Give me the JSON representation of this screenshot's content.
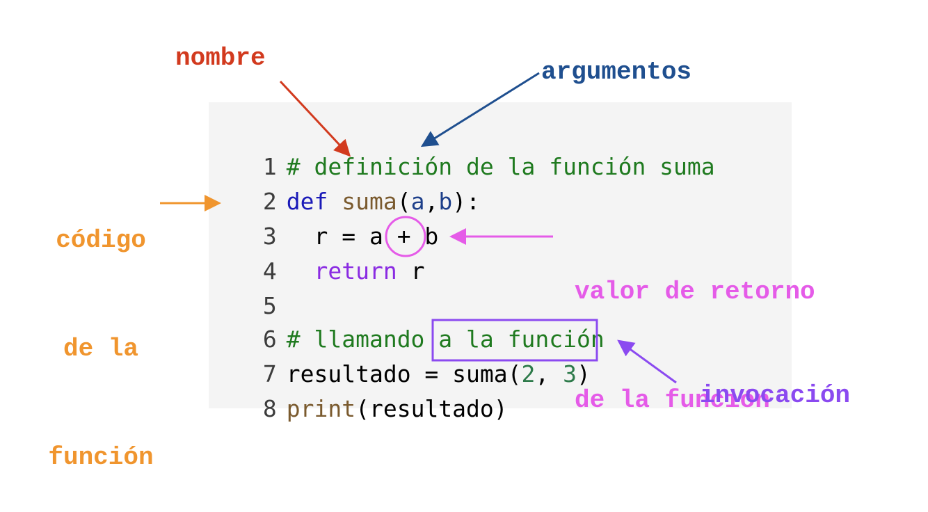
{
  "code": {
    "lines": [
      {
        "num": "1",
        "comment": "# definición de la función suma"
      },
      {
        "num": "2",
        "kw": "def",
        "fn": "suma",
        "paren_open": "(",
        "a": "a",
        "comma": ",",
        "b": "b",
        "paren_close": "):"
      },
      {
        "num": "3",
        "text": "  r = a + b"
      },
      {
        "num": "4",
        "indent": "  ",
        "kw": "return",
        "space": " ",
        "r": "r"
      },
      {
        "num": "5"
      },
      {
        "num": "6",
        "comment": "# llamando a la función"
      },
      {
        "num": "7",
        "lhs": "resultado = ",
        "fn": "suma",
        "paren_open": "(",
        "n1": "2",
        "comma": ", ",
        "n2": "3",
        "paren_close": ")"
      },
      {
        "num": "8",
        "fn": "print",
        "paren_open": "(",
        "arg": "resultado",
        "paren_close": ")"
      }
    ]
  },
  "annotations": {
    "nombre": "nombre",
    "argumentos": "argumentos",
    "codigo_funcion": [
      "código",
      "de la",
      "función"
    ],
    "valor_retorno": [
      "valor de retorno",
      "de la función"
    ],
    "invocacion": "invocación"
  },
  "colors": {
    "nombre": "#d23a1e",
    "argumentos": "#1f4f8f",
    "codigo_funcion": "#f0952e",
    "valor_retorno": "#e55be8",
    "invocacion": "#8b4af0"
  }
}
